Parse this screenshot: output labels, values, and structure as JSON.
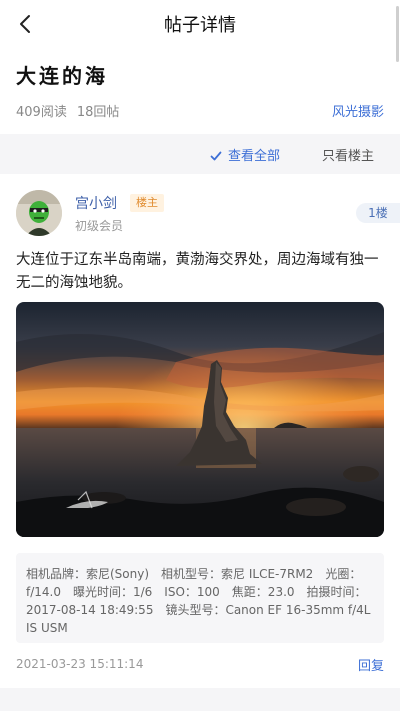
{
  "nav": {
    "title": "帖子详情",
    "back_icon": "chevron-left-icon"
  },
  "post": {
    "title": "大连的海",
    "reads": "409阅读",
    "replies": "18回帖",
    "category": "风光摄影"
  },
  "filter": {
    "view_all": "查看全部",
    "owner_only": "只看楼主",
    "check_icon": "check-icon"
  },
  "floor_post": {
    "author": "宫小剑",
    "badge": "楼主",
    "level": "初级会员",
    "floor": "1楼",
    "content": "大连位于辽东半岛南端，黄渤海交界处，周边海域有独一无二的海蚀地貌。",
    "exif": "相机品牌：索尼(Sony)　相机型号：索尼 ILCE-7RM2　光圈：f/14.0　曝光时间：1/6　ISO：100　焦距：23.0　拍摄时间：2017-08-14 18:49:55　镜头型号：Canon EF 16-35mm f/4L IS USM",
    "date": "2021-03-23 15:11:14",
    "reply": "回复"
  },
  "colors": {
    "accent": "#3d6fd6",
    "badge_bg": "#fff2e0",
    "badge_text": "#e08a2c"
  }
}
